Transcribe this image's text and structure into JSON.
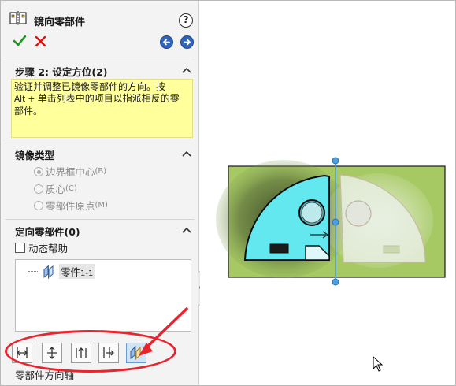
{
  "window": {
    "title": "镜向零部件"
  },
  "toolbar": {
    "ok_icon": "check-icon",
    "cancel_icon": "close-icon",
    "back_icon": "arrow-left-icon",
    "forward_icon": "arrow-right-icon",
    "help_label": "?"
  },
  "step_section": {
    "title": "步骤 2: 设定方位(2)",
    "message_line1": "验证并调整已镜像零部件的方向。按",
    "message_line2_small": "Alt + ",
    "message_line2": "单击列表中的项目以指派相反的零",
    "message_line3": "部件。"
  },
  "mirror_type": {
    "title": "镜像类型",
    "options": [
      {
        "label": "边界框中心",
        "suffix": "(B)",
        "selected": true
      },
      {
        "label": "质心",
        "suffix": "(C)",
        "selected": false
      },
      {
        "label": "零部件原点",
        "suffix": "(M)",
        "selected": false
      }
    ]
  },
  "orient": {
    "title": "定向零部件(0)",
    "dynamic_help": "动态帮助",
    "list_items": [
      {
        "label": "零件",
        "suffix": "1-1"
      }
    ]
  },
  "orient_buttons": [
    "orient-x-icon",
    "orient-y-icon",
    "orient-z-icon",
    "orient-xy-icon",
    "mirror-part-icon"
  ],
  "bottom_label": "零部件方向轴",
  "colors": {
    "highlight": "#ffff9b",
    "annotation": "#e8242e",
    "plane": "#4aa0e0",
    "part_fill": "#63e8ef",
    "background_plate": "#a6c964"
  }
}
